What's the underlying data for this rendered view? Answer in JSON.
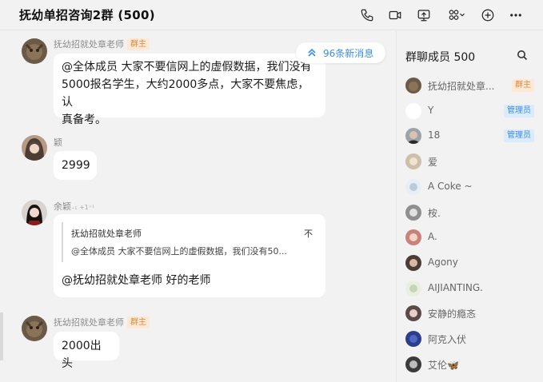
{
  "header": {
    "title": "抚幼单招咨询2群 (500)",
    "icons": [
      "phone-icon",
      "video-icon",
      "screen-share-icon",
      "apps-grid-icon",
      "add-icon",
      "more-icon"
    ]
  },
  "new_messages": {
    "label": "96条新消息"
  },
  "messages": [
    {
      "sender": "抚幼招就处章老师",
      "badge": "群主",
      "text_lines": [
        "@全体成员 大家不要信网上的虚假数据，我们没有",
        "5000报名学生，大约2000多点，大家不要焦虑，认",
        "真备考。"
      ]
    },
    {
      "sender": "颖",
      "text": "2999"
    },
    {
      "sender": "余颖",
      "sender_suffix": "₊₁ +1⁺¹",
      "quote": {
        "author": "抚幼招就处章老师",
        "close": "不",
        "text": "@全体成员  大家不要信网上的虚假数据，我们没有50..."
      },
      "text": "@抚幼招就处章老师 好的老师"
    },
    {
      "sender": "抚幼招就处章老师",
      "badge": "群主",
      "text": "2000出头"
    }
  ],
  "members": {
    "title": "群聊成员 500",
    "list": [
      {
        "name": "抚幼招就处章...",
        "badge": "群主",
        "badge_type": "owner"
      },
      {
        "name": "Y",
        "badge": "管理员",
        "badge_type": "admin"
      },
      {
        "name": "18",
        "badge": "管理员",
        "badge_type": "admin"
      },
      {
        "name": "爱",
        "badge": ""
      },
      {
        "name": "A Coke ~",
        "badge": ""
      },
      {
        "name": "桉.",
        "badge": ""
      },
      {
        "name": "A.",
        "badge": ""
      },
      {
        "name": "Agony",
        "badge": ""
      },
      {
        "name": "AIJIANTING.",
        "badge": ""
      },
      {
        "name": "安静的瘾忞",
        "badge": ""
      },
      {
        "name": "阿克入伏",
        "badge": ""
      },
      {
        "name": "艾伦🦋",
        "badge": ""
      }
    ]
  },
  "colors": {
    "background": "#f2f2f2",
    "bubble": "#ffffff",
    "accent_blue": "#3a8ee6",
    "owner_orange": "#e8853a"
  }
}
